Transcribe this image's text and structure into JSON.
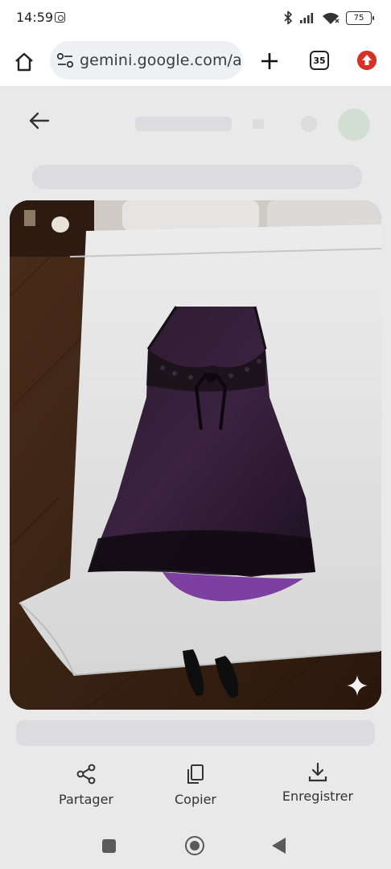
{
  "status_bar": {
    "time": "14:59",
    "battery_level": "75",
    "icons": [
      "instagram-icon",
      "bluetooth-icon",
      "signal-icon",
      "wifi-icon",
      "battery-icon"
    ]
  },
  "browser": {
    "url": "gemini.google.com/ap",
    "tab_count": "35",
    "icons": [
      "home-icon",
      "site-settings-icon",
      "plus-icon",
      "tab-switcher-icon",
      "update-icon"
    ],
    "update_color": "#d93025"
  },
  "viewer": {
    "image_description_icon": "sparkle-icon",
    "actions": [
      {
        "label": "Partager",
        "icon": "share-icon"
      },
      {
        "label": "Copier",
        "icon": "copy-icon"
      },
      {
        "label": "Enregistrer",
        "icon": "download-icon"
      }
    ]
  },
  "nav": {
    "icons": [
      "recent-apps-icon",
      "home-circle-icon",
      "back-triangle-icon"
    ]
  }
}
